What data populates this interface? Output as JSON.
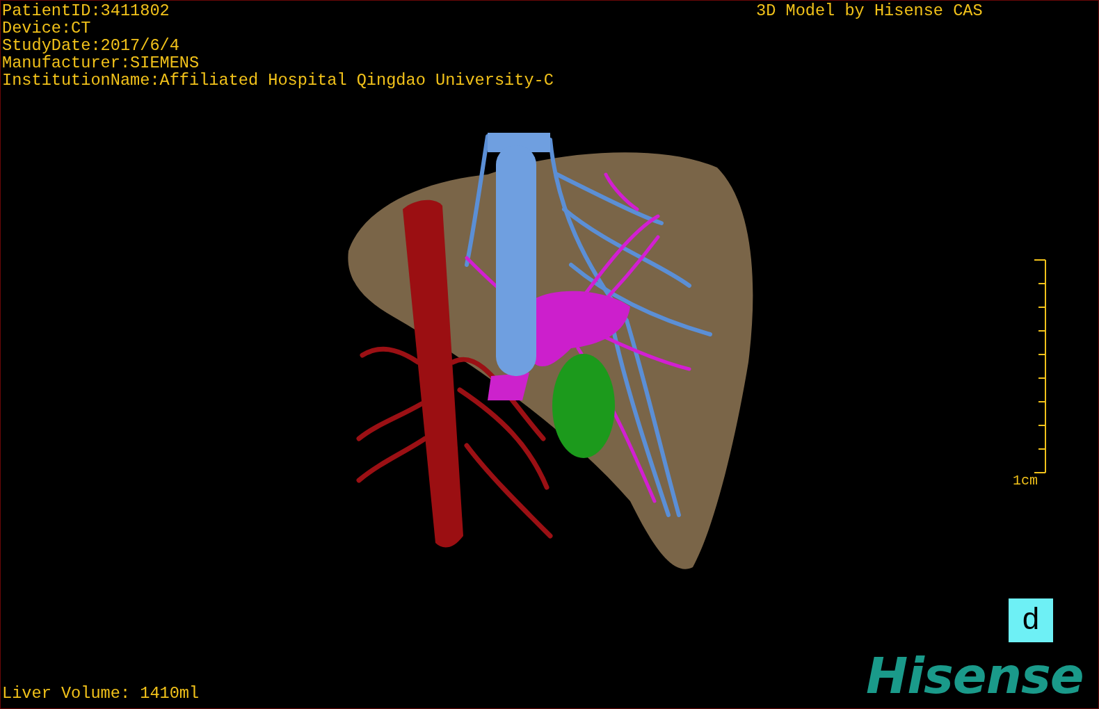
{
  "header_lines": [
    "PatientID:3411802",
    "Device:CT",
    "StudyDate:2017/6/4",
    "Manufacturer:SIEMENS",
    "InstitutionName:Affiliated Hospital Qingdao University-C"
  ],
  "credit": "3D Model by Hisense CAS",
  "scale_bar": {
    "label": "1cm"
  },
  "orientation_cube": {
    "label": "d"
  },
  "logo": "Hisense",
  "footer": "Liver Volume: 1410ml"
}
